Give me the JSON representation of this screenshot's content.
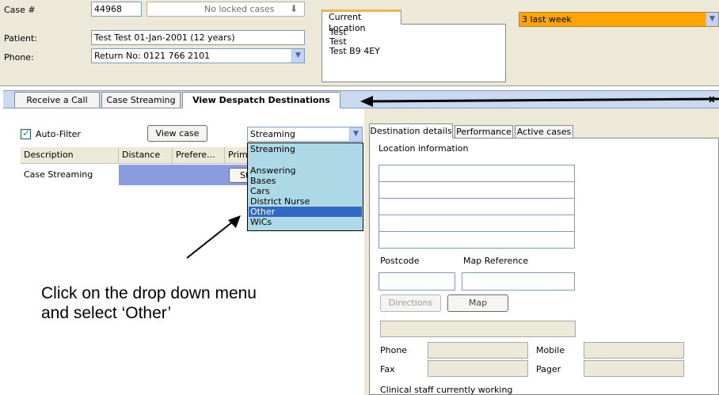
{
  "header": {
    "case_label": "Case #",
    "case_number": "44968",
    "locked_cases": "No locked cases",
    "patient_label": "Patient:",
    "patient_value": "Test Test  01-Jan-2001 (12 years)",
    "phone_label": "Phone:",
    "phone_value": "Return No: 0121 766 2101",
    "location_tab": "Current Location",
    "location_lines": [
      "Test",
      "Test",
      "Test B9 4EY"
    ],
    "priority_value": "3 last week",
    "priority_color": "#ffa500"
  },
  "tabs": [
    {
      "label": "Receive a Call"
    },
    {
      "label": "Case Streaming"
    },
    {
      "label": "View Despatch Destinations",
      "active": true
    }
  ],
  "close_label": "x",
  "left": {
    "auto_filter_label": "Auto-Filter",
    "auto_filter_checked": true,
    "view_case_label": "View case",
    "streaming_selected": "Streaming",
    "columns": [
      "Description",
      "Distance",
      "Prefere...",
      "Prim"
    ],
    "rows": [
      {
        "description": "Case Streaming",
        "button_fragment": "St"
      }
    ],
    "dropdown_options": [
      "Streaming",
      "",
      "Answering",
      "Bases",
      "Cars",
      "District Nurse",
      "Other",
      "WiCs"
    ],
    "dropdown_selected_index": 6
  },
  "right": {
    "tabs": [
      "Destination details",
      "Performance",
      "Active cases"
    ],
    "location_info": "Location information",
    "postcode_label": "Postcode",
    "map_ref_label": "Map Reference",
    "directions_label": "Directions",
    "map_label": "Map",
    "phone_label": "Phone",
    "mobile_label": "Mobile",
    "fax_label": "Fax",
    "pager_label": "Pager",
    "clinical_staff": "Clinical staff currently working"
  },
  "annotation": {
    "line1": "Click on the drop down menu",
    "line2": "and select ‘Other’"
  }
}
